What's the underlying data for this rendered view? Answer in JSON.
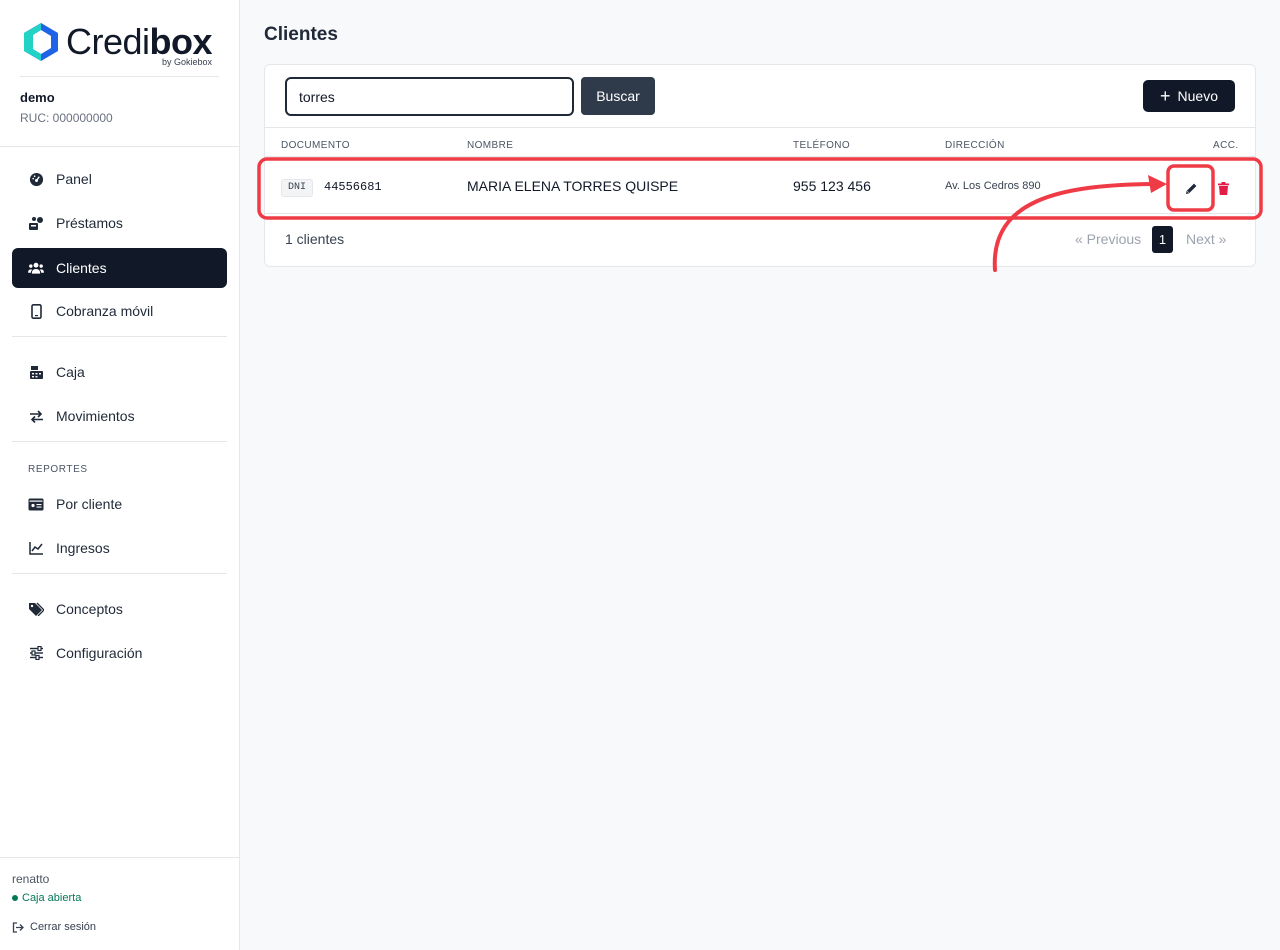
{
  "brand": {
    "name_light": "Credi",
    "name_bold": "box",
    "tagline": "by Gokiebox",
    "colors": {
      "mark_blue": "#1f63e6",
      "mark_cyan": "#22d3c5"
    }
  },
  "org": {
    "name": "demo",
    "ruc": "RUC: 000000000"
  },
  "sidebar": {
    "items": [
      {
        "label": "Panel",
        "icon": "dashboard-icon"
      },
      {
        "label": "Préstamos",
        "icon": "loans-icon"
      },
      {
        "label": "Clientes",
        "icon": "users-icon",
        "active": true
      },
      {
        "label": "Cobranza móvil",
        "icon": "mobile-icon"
      },
      {
        "label": "Caja",
        "icon": "cash-register-icon"
      },
      {
        "label": "Movimientos",
        "icon": "transfer-icon"
      },
      {
        "label": "Por cliente",
        "icon": "id-card-icon"
      },
      {
        "label": "Ingresos",
        "icon": "chart-line-icon"
      },
      {
        "label": "Conceptos",
        "icon": "tags-icon"
      },
      {
        "label": "Configuración",
        "icon": "sliders-icon"
      }
    ],
    "section_reportes": "REPORTES"
  },
  "session": {
    "user": "renatto",
    "caja_status": "Caja abierta",
    "logout_label": "Cerrar sesión"
  },
  "page": {
    "title": "Clientes"
  },
  "toolbar": {
    "search_value": "torres",
    "search_button": "Buscar",
    "new_button": "Nuevo"
  },
  "table": {
    "headers": {
      "documento": "DOCUMENTO",
      "nombre": "NOMBRE",
      "telefono": "TELÉFONO",
      "direccion": "DIRECCIÓN",
      "acciones": "ACC."
    },
    "rows": [
      {
        "doc_type": "DNI",
        "doc_number": "44556681",
        "nombre": "MARIA ELENA TORRES QUISPE",
        "telefono": "955 123 456",
        "direccion": "Av. Los Cedros 890"
      }
    ]
  },
  "footer": {
    "count": "1 clientes",
    "previous": "« Previous",
    "page": "1",
    "next": "Next »"
  },
  "annotation": {
    "color": "#ef3b45"
  }
}
